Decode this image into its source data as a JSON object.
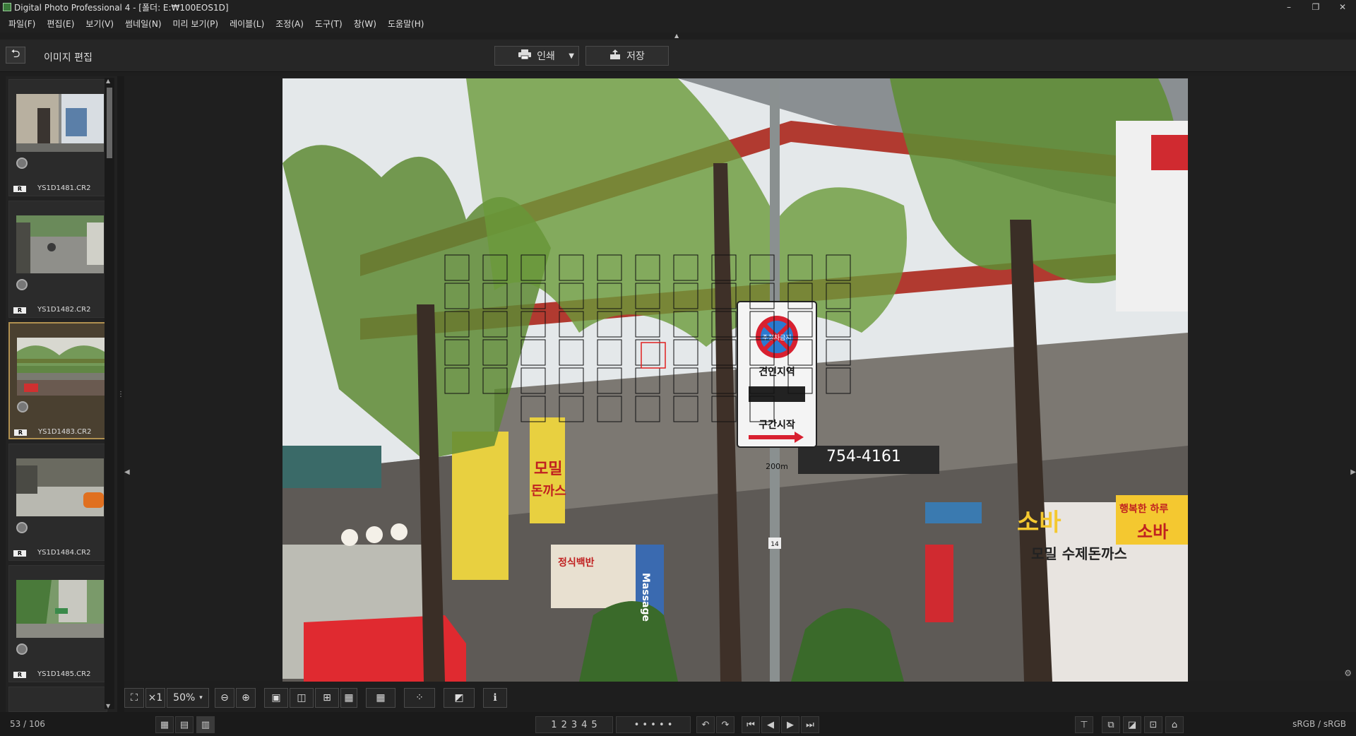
{
  "window": {
    "title": "Digital Photo Professional 4 - [폴더: E:₩100EOS1D]",
    "icons": [
      "app-icon",
      "minimize-icon",
      "restore-icon",
      "close-icon"
    ],
    "minimize_glyph": "–",
    "restore_glyph": "❐",
    "close_glyph": "✕"
  },
  "menu": {
    "items": [
      "파일(F)",
      "편집(E)",
      "보기(V)",
      "썸네일(N)",
      "미리 보기(P)",
      "레이블(L)",
      "조정(A)",
      "도구(T)",
      "창(W)",
      "도움말(H)"
    ]
  },
  "toolbar": {
    "back_glyph": "⮌",
    "edit_label": "이미지 편집",
    "print_label": "인쇄",
    "print_dropdown_glyph": "▼",
    "save_label": "저장",
    "print_icon": "printer-icon",
    "save_icon": "save-icon"
  },
  "thumbnails": {
    "items": [
      {
        "name": "YS1D1481.CR2",
        "badge": "R",
        "selected": false
      },
      {
        "name": "YS1D1482.CR2",
        "badge": "R",
        "selected": false
      },
      {
        "name": "YS1D1483.CR2",
        "badge": "R",
        "selected": true
      },
      {
        "name": "YS1D1484.CR2",
        "badge": "R",
        "selected": false
      },
      {
        "name": "YS1D1485.CR2",
        "badge": "R",
        "selected": false
      }
    ]
  },
  "photo": {
    "sign_top": "주정차금지",
    "sign_mid": "견인지역",
    "sign_bottom": "구간시작",
    "sign_distance": "200m",
    "shop_number": "754-4161",
    "shop_sign_1": "소바",
    "shop_sign_2": "행복한 하루",
    "shop_sign_3": "소바",
    "shop_sign_4": "모밀",
    "shop_sign_5": "돈까스",
    "shop_sign_6": "모밀 수제돈까스",
    "shop_sign_7": "정식백반",
    "shop_sign_8": "Massage",
    "pole_tag": "14"
  },
  "viewbar": {
    "fit_glyph": "⛶",
    "zoom_1x": "×1",
    "zoom_level": "50%",
    "dropdown_glyph": "▾",
    "zoom_out_glyph": "⊖",
    "zoom_in_glyph": "⊕",
    "info_glyph": "ℹ"
  },
  "status": {
    "counter": "53 / 106",
    "ratings": [
      "1",
      "2",
      "3",
      "4",
      "5"
    ],
    "color_space": "sRGB / sRGB"
  }
}
